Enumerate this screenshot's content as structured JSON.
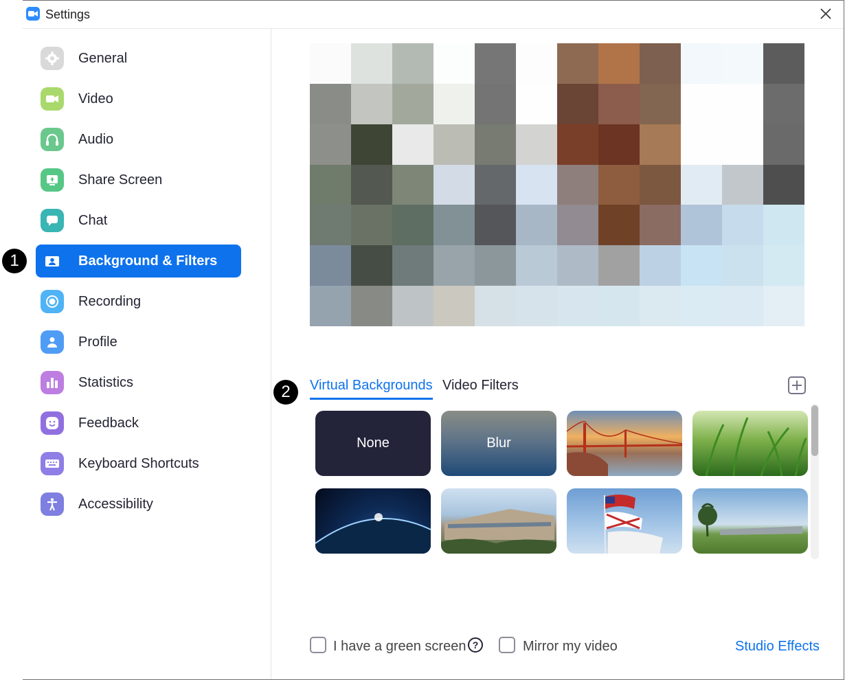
{
  "window": {
    "title": "Settings"
  },
  "sidebar": {
    "items": [
      {
        "label": "General",
        "icon": "gear-icon",
        "color": "#d6d6d6"
      },
      {
        "label": "Video",
        "icon": "video-camera-icon",
        "color": "#a9d96c"
      },
      {
        "label": "Audio",
        "icon": "headphones-icon",
        "color": "#6ac88d"
      },
      {
        "label": "Share Screen",
        "icon": "share-screen-icon",
        "color": "#56c785"
      },
      {
        "label": "Chat",
        "icon": "chat-bubble-icon",
        "color": "#39b5b3"
      },
      {
        "label": "Background & Filters",
        "icon": "person-card-icon",
        "color": "#ffffff",
        "active": true
      },
      {
        "label": "Recording",
        "icon": "record-icon",
        "color": "#4fb3f6"
      },
      {
        "label": "Profile",
        "icon": "person-icon",
        "color": "#4f9cf5"
      },
      {
        "label": "Statistics",
        "icon": "bar-chart-icon",
        "color": "#bd7de1"
      },
      {
        "label": "Feedback",
        "icon": "smiley-icon",
        "color": "#9070e0"
      },
      {
        "label": "Keyboard Shortcuts",
        "icon": "keyboard-icon",
        "color": "#8f7ee6"
      },
      {
        "label": "Accessibility",
        "icon": "accessibility-icon",
        "color": "#7e7fe0"
      }
    ]
  },
  "annotations": {
    "badge_1": "1",
    "badge_2": "2"
  },
  "main": {
    "tabs": [
      {
        "label": "Virtual Backgrounds",
        "active": true
      },
      {
        "label": "Video Filters",
        "active": false
      }
    ],
    "backgrounds": [
      {
        "label": "None",
        "kind": "none"
      },
      {
        "label": "Blur",
        "kind": "blur"
      },
      {
        "label": "",
        "kind": "golden-gate-bridge"
      },
      {
        "label": "",
        "kind": "grass"
      },
      {
        "label": "",
        "kind": "earth-from-space"
      },
      {
        "label": "",
        "kind": "college-building"
      },
      {
        "label": "",
        "kind": "flags"
      },
      {
        "label": "",
        "kind": "campus-lawn"
      }
    ],
    "green_screen_label": "I have a green screen",
    "mirror_label": "Mirror my video",
    "studio_effects_label": "Studio Effects",
    "help_glyph": "?"
  },
  "colors": {
    "accent": "#0e72ed",
    "active_tab": "#0e72ed"
  }
}
